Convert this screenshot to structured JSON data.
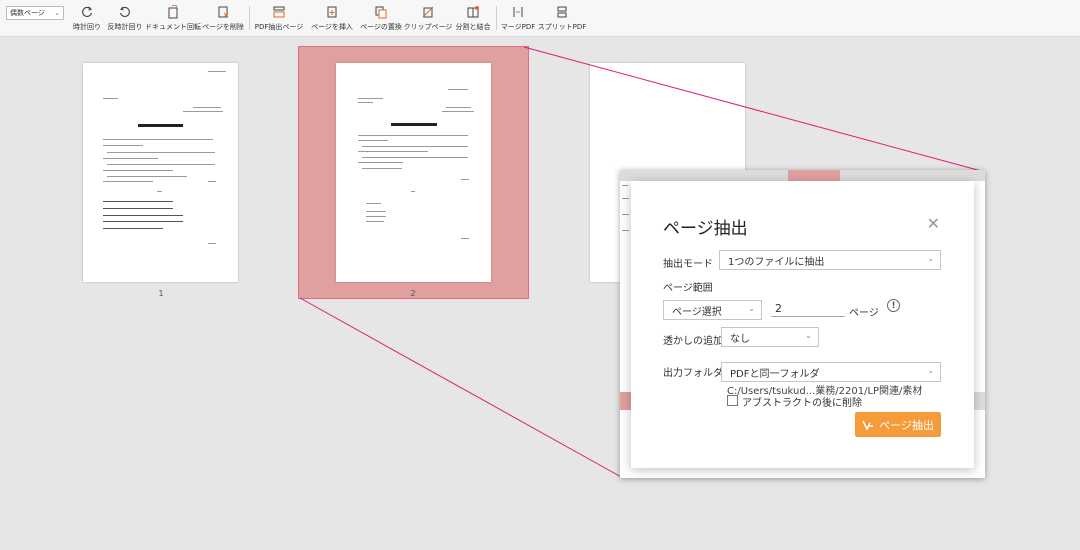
{
  "toolbar": {
    "page_select": "偶数ページ",
    "tools": [
      {
        "label": "時計回り",
        "icon": "rotate-cw-icon"
      },
      {
        "label": "反時計回り",
        "icon": "rotate-ccw-icon"
      },
      {
        "label": "ドキュメント回転",
        "icon": "doc-rotate-icon"
      },
      {
        "label": "ページを削除",
        "icon": "page-delete-icon"
      },
      {
        "label": "PDF抽出ページ",
        "icon": "pdf-extract-icon"
      },
      {
        "label": "ページを挿入",
        "icon": "page-insert-icon"
      },
      {
        "label": "ページの置換",
        "icon": "page-replace-icon"
      },
      {
        "label": "クリップページ",
        "icon": "clip-page-icon"
      },
      {
        "label": "分割と結合",
        "icon": "split-merge-icon"
      },
      {
        "label": "マージPDF",
        "icon": "merge-pdf-icon"
      },
      {
        "label": "スプリットPDF",
        "icon": "split-pdf-icon"
      }
    ]
  },
  "thumbnails": {
    "page1": "1",
    "page2": "2"
  },
  "dialog": {
    "title": "ページ抽出",
    "extract_mode_label": "抽出モード",
    "extract_mode_value": "1つのファイルに抽出",
    "page_range_label": "ページ範囲",
    "page_range_mode": "ページ選択",
    "page_number": "2",
    "page_unit": "ページ",
    "watermark_label": "透かしの追加",
    "watermark_value": "なし",
    "output_folder_label": "出力フォルダ",
    "output_folder_value": "PDFと同一フォルダ",
    "output_path": "C:/Users/tsukud...業務/2201/LP関連/素材",
    "abstract_checkbox_label": "アブストラクトの後に削除",
    "extract_button_label": "ページ抽出"
  },
  "colors": {
    "highlight": "#e1a0a0",
    "accent_line": "#e0197a",
    "button": "#f59b3a"
  }
}
